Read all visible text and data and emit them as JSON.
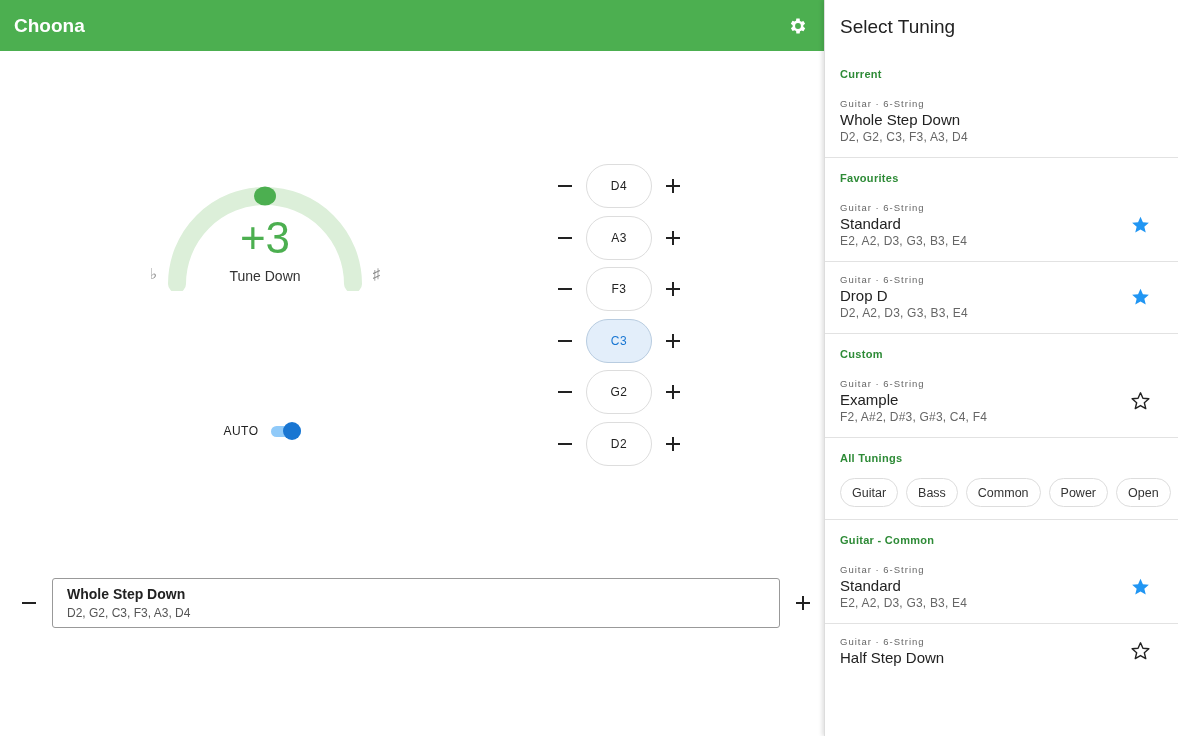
{
  "app_bar": {
    "title": "Choona"
  },
  "tuner": {
    "offset": "+3",
    "hint": "Tune Down",
    "level": 0.5,
    "flat_label": "♭",
    "sharp_label": "♯"
  },
  "auto": {
    "label": "AUTO",
    "on": true
  },
  "strings": [
    {
      "note": "D4",
      "selected": false
    },
    {
      "note": "A3",
      "selected": false
    },
    {
      "note": "F3",
      "selected": false
    },
    {
      "note": "C3",
      "selected": true
    },
    {
      "note": "G2",
      "selected": false
    },
    {
      "note": "D2",
      "selected": false
    }
  ],
  "current_tuning": {
    "name": "Whole Step Down",
    "notes": "D2, G2, C3, F3, A3, D4"
  },
  "panel": {
    "title": "Select Tuning",
    "sections": [
      {
        "title": "Current",
        "items": [
          {
            "category": "Guitar · 6-String",
            "name": "Whole Step Down",
            "notes": "D2, G2, C3, F3, A3, D4"
          }
        ]
      },
      {
        "title": "Favourites",
        "items": [
          {
            "category": "Guitar · 6-String",
            "name": "Standard",
            "notes": "E2, A2, D3, G3, B3, E4",
            "favourite": true
          },
          {
            "category": "Guitar · 6-String",
            "name": "Drop D",
            "notes": "D2, A2, D3, G3, B3, E4",
            "favourite": true
          }
        ]
      },
      {
        "title": "Custom",
        "items": [
          {
            "category": "Guitar · 6-String",
            "name": "Example",
            "notes": "F2, A#2, D#3, G#3, C4, F4",
            "favourite": false
          }
        ]
      },
      {
        "title": "All Tunings",
        "chips": [
          "Guitar",
          "Bass",
          "Common",
          "Power",
          "Open"
        ]
      },
      {
        "title": "Guitar - Common",
        "items": [
          {
            "category": "Guitar · 6-String",
            "name": "Standard",
            "notes": "E2, A2, D3, G3, B3, E4",
            "favourite": true
          },
          {
            "category": "Guitar · 6-String",
            "name": "Half Step Down",
            "favourite": false
          }
        ]
      }
    ]
  }
}
